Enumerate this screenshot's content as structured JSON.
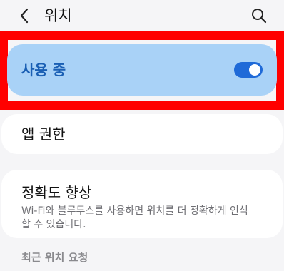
{
  "header": {
    "title": "위치",
    "back_icon": "chevron-left-icon",
    "search_icon": "search-icon"
  },
  "location_toggle": {
    "label": "사용 중",
    "enabled": true
  },
  "items": [
    {
      "label": "앱 권한"
    },
    {
      "label": "정확도 향상",
      "description": "Wi-Fi와 블루투스를 사용하면 위치를 더 정확하게 인식할 수 있습니다."
    }
  ],
  "section_header": "최근 위치 요청",
  "colors": {
    "highlight_frame": "#ff0000",
    "toggle_card": "#a9d2f7",
    "toggle_label": "#1a5fb4",
    "switch_on": "#1f6ad8"
  }
}
